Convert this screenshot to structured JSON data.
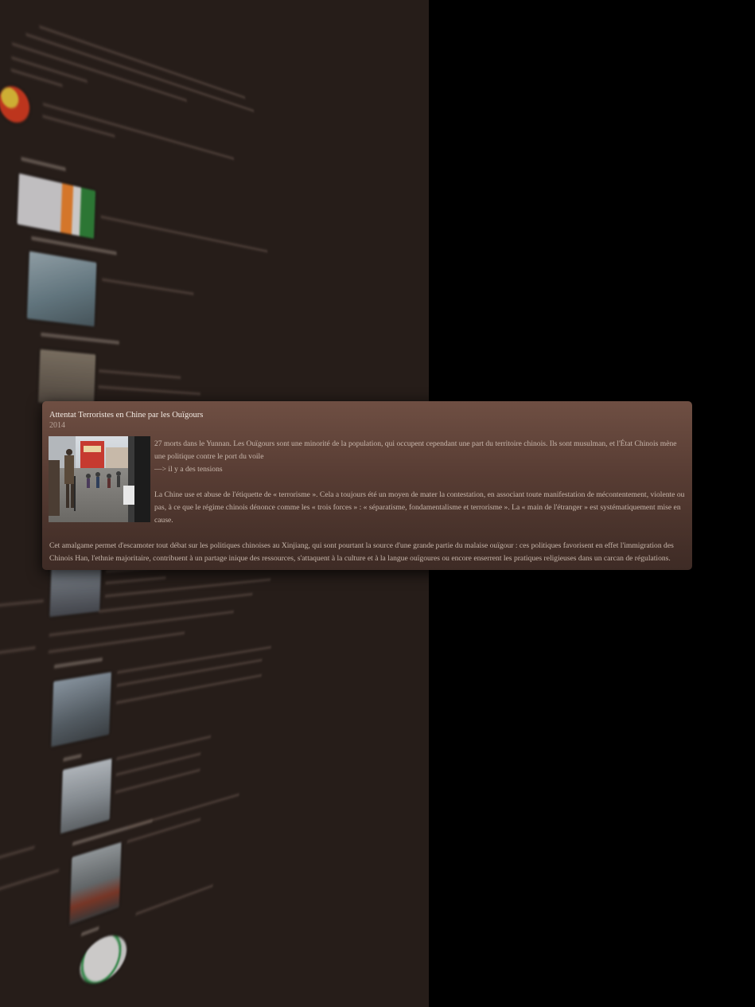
{
  "card": {
    "title": "Attentat Terroristes en Chine par les Ouïgours",
    "year": "2014",
    "paragraph1": "27 morts dans le Yunnan. Les Ouïgours sont une minorité de la population, qui occupent cependant une part du territoire chinois. Ils sont musulman, et l'État Chinois mène une politique contre le port du voile",
    "paragraph1_tail": "—> il y a des tensions",
    "paragraph2": "La Chine use et abuse de l'étiquette de « terrorisme ». Cela a toujours été un moyen de mater la contestation, en associant toute manifestation de mécontentement, violente ou pas, à ce que le régime chinois dénonce comme les « trois forces » : « séparatisme, fondamentalisme et terrorisme ». La « main de l'étranger » est systématiquement mise en cause.",
    "paragraph3": "Cet amalgame permet d'escamoter tout débat sur les politiques chinoises au Xinjiang, qui sont pourtant la source d'une grande partie du malaise ouïgour : ces politiques favorisent en effet l'immigration des Chinois Han, l'ethnie majoritaire, contribuent à un partage inique des ressources, s'attaquent à la culture et à la langue ouïgoures ou encore enserrent les pratiques religieuses dans un carcan de régulations."
  },
  "colors": {
    "card_top": "#6f4f43",
    "card_bottom": "#3e2b25",
    "panel_bg": "#261d19",
    "outer_bg": "#000000"
  },
  "icons": {
    "yin_yang": "yin-yang-icon",
    "flag": "india-flag-icon"
  }
}
